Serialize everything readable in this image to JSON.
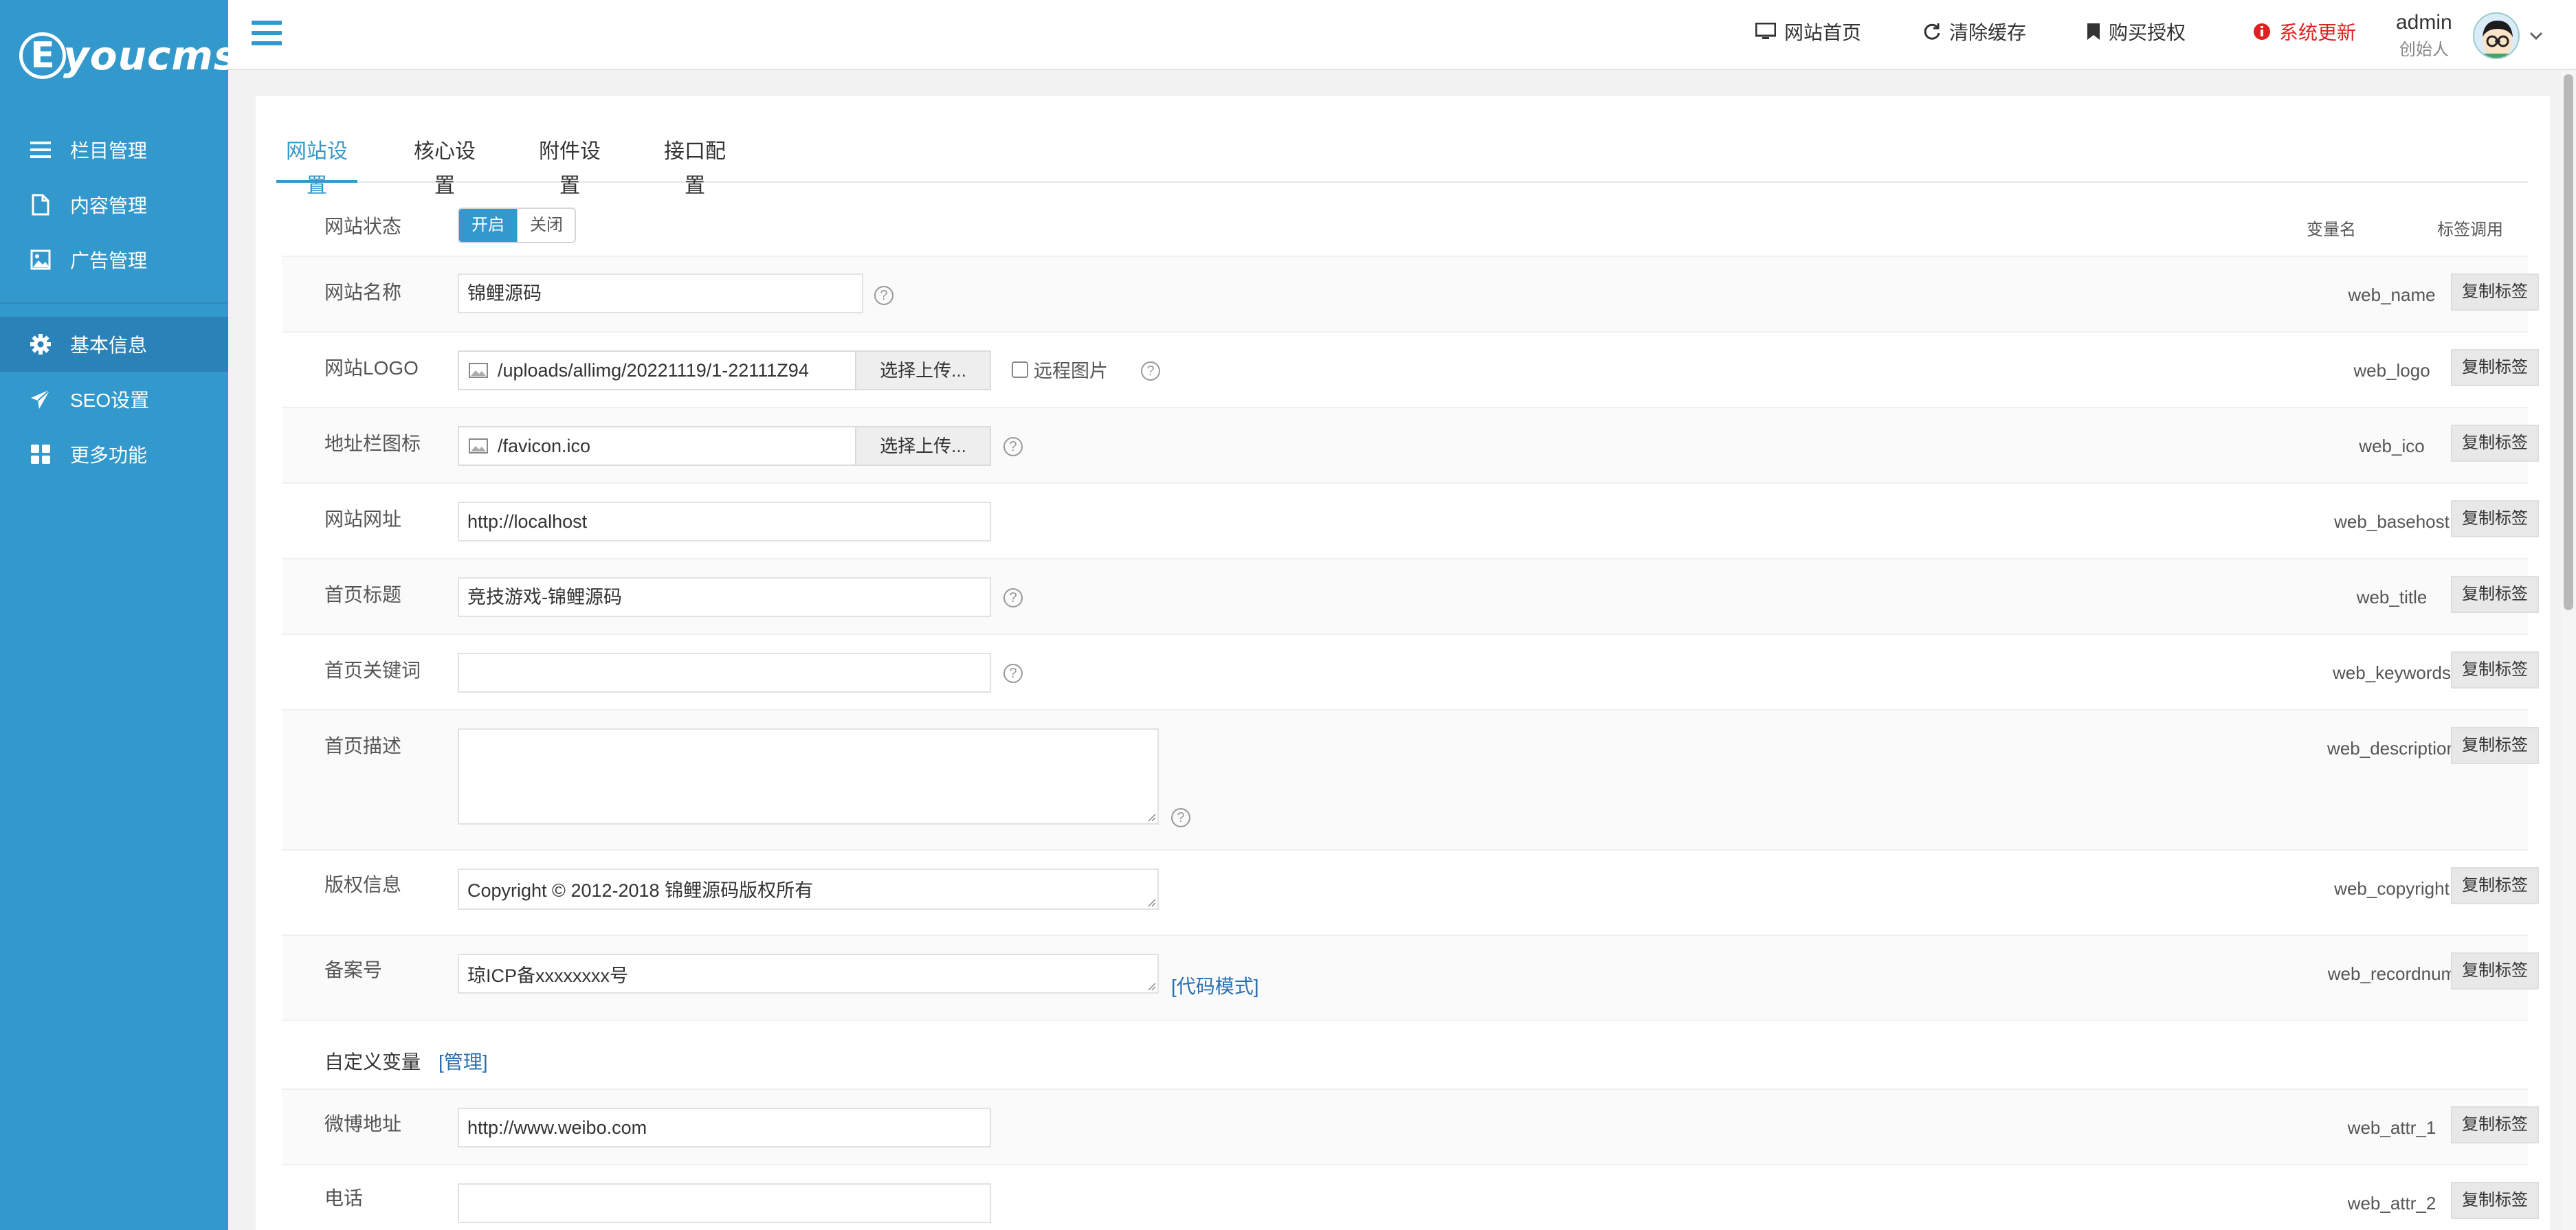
{
  "app": {
    "logo_text": "youcms",
    "logo_letter": "E"
  },
  "sidebar": {
    "items": [
      {
        "label": "栏目管理",
        "icon": "list-icon"
      },
      {
        "label": "内容管理",
        "icon": "document-icon"
      },
      {
        "label": "广告管理",
        "icon": "image-icon"
      },
      {
        "label": "基本信息",
        "icon": "gear-icon",
        "active": true
      },
      {
        "label": "SEO设置",
        "icon": "paper-plane-icon"
      },
      {
        "label": "更多功能",
        "icon": "grid-icon"
      }
    ]
  },
  "header": {
    "links": [
      {
        "label": "网站首页",
        "icon": "monitor-icon"
      },
      {
        "label": "清除缓存",
        "icon": "refresh-icon"
      },
      {
        "label": "购买授权",
        "icon": "bookmark-icon"
      },
      {
        "label": "系统更新",
        "icon": "info-icon",
        "color": "#e02020"
      }
    ],
    "user": {
      "name": "admin",
      "role": "创始人"
    }
  },
  "tabs": [
    {
      "label": "网站设置",
      "active": true
    },
    {
      "label": "核心设置"
    },
    {
      "label": "附件设置"
    },
    {
      "label": "接口配置"
    }
  ],
  "table": {
    "col_var": "变量名",
    "col_tag": "标签调用",
    "copy_label": "复制标签"
  },
  "status": {
    "label": "网站状态",
    "on": "开启",
    "off": "关闭",
    "value": "开启"
  },
  "fields": {
    "web_name": {
      "label": "网站名称",
      "value": "锦鲤源码",
      "var": "web_name"
    },
    "web_logo": {
      "label": "网站LOGO",
      "value": "/uploads/allimg/20221119/1-22111Z94",
      "button": "选择上传...",
      "remote": "远程图片",
      "var": "web_logo"
    },
    "web_ico": {
      "label": "地址栏图标",
      "value": "/favicon.ico",
      "button": "选择上传...",
      "var": "web_ico"
    },
    "web_basehost": {
      "label": "网站网址",
      "value": "http://localhost",
      "var": "web_basehost"
    },
    "web_title": {
      "label": "首页标题",
      "value": "竞技游戏-锦鲤源码",
      "var": "web_title"
    },
    "web_keywords": {
      "label": "首页关键词",
      "value": "",
      "var": "web_keywords"
    },
    "web_description": {
      "label": "首页描述",
      "value": "",
      "var": "web_description"
    },
    "web_copyright": {
      "label": "版权信息",
      "value": "Copyright © 2012-2018 锦鲤源码版权所有",
      "var": "web_copyright"
    },
    "web_recordnum": {
      "label": "备案号",
      "value": "琼ICP备xxxxxxxx号",
      "link": "[代码模式]",
      "var": "web_recordnum"
    },
    "web_attr_1": {
      "label": "微博地址",
      "value": "http://www.weibo.com",
      "var": "web_attr_1"
    },
    "web_attr_2": {
      "label": "电话",
      "value": "",
      "var": "web_attr_2"
    }
  },
  "custom_vars": {
    "label": "自定义变量",
    "manage": "[管理]"
  },
  "colors": {
    "accent": "#3398cc",
    "sidebar_active": "#2a82b8",
    "alert": "#e02020",
    "link": "#2a6fb0"
  }
}
